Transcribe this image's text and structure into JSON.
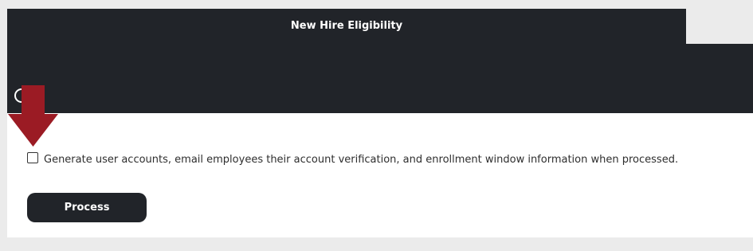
{
  "header": {
    "title": "New Hire Eligibility"
  },
  "icons": {
    "help": "help-circle-icon",
    "annotation": "arrow-down-icon"
  },
  "form": {
    "generate_accounts_label": "Generate user accounts, email employees their account verification, and enrollment window information when processed.",
    "generate_accounts_checked": false,
    "process_label": "Process"
  },
  "colors": {
    "header_background": "#212429",
    "page_background": "#ebebeb",
    "content_background": "#ffffff",
    "annotation_arrow": "#9b1b24",
    "button_background": "#212429",
    "button_text": "#ffffff"
  }
}
